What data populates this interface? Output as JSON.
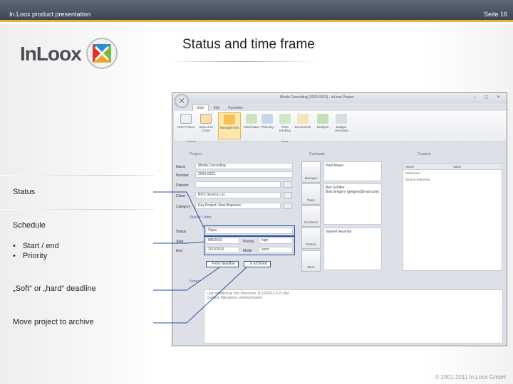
{
  "slide": {
    "header_left": "In.Loox product presentation",
    "header_right": "Seite 16",
    "title": "Status and time frame",
    "footer": "© 2001-2011 In.Loox GmbH"
  },
  "logo": {
    "text": "InLoox"
  },
  "callouts": {
    "status": "Status",
    "schedule": "Schedule",
    "bullets": [
      "Start / end",
      "Priority"
    ],
    "deadline": "„Soft“ or „hard“ deadline",
    "archive": "Move project to archive"
  },
  "window": {
    "title": "Media Consulting (2009-0023) - InLoox Project",
    "tabs": [
      "Start",
      "Edit",
      "Favorites"
    ],
    "ribbon_buttons": [
      "New Project",
      "Save and Close",
      "Management",
      "Mind Maps",
      "Planning",
      "Time tracking",
      "Documents",
      "Budgets",
      "Budget Overview"
    ],
    "ribbon_groups": [
      "Actions",
      "Views"
    ],
    "project_section": "Project",
    "project_fields": [
      {
        "label": "Name",
        "value": "Media Consulting"
      },
      {
        "label": "Number",
        "value": "2009-0023"
      },
      {
        "label": "Division",
        "value": ""
      },
      {
        "label": "Client",
        "value": "BOS Service Ltd."
      },
      {
        "label": "Category",
        "value": "Key Project; New Business"
      }
    ],
    "contacts_section": "Contacts",
    "contact_buttons": [
      "Manager",
      "Team",
      "Customer",
      "Partner",
      "More"
    ],
    "contacts": [
      "Paul Meyer",
      "Ben Schiller\nBob Gregory (gregory@mail.com)",
      "Gabriel Neuman"
    ],
    "custom_section": "Custom",
    "custom_headers": [
      "Name",
      "Value"
    ],
    "custom_rows": [
      "Reference",
      "Source reference"
    ],
    "status_section": "Status / time",
    "status_label": "Status",
    "status_value": "Open",
    "start_label": "Start",
    "start_value": "8/8/2010",
    "end_label": "End",
    "end_value": "2/31/2010",
    "priority_label": "Priority",
    "priority_value": "high",
    "mode_label": "Mode",
    "mode_value": "soon",
    "fixed_deadline": "Fixed deadline",
    "archived": "Is archived",
    "notes_section": "Notes",
    "notes_line1": "Last modified by Info Devcheck 11/12/2012 4:21 AM",
    "notes_line2": "Contact, Wassimoo communication"
  }
}
